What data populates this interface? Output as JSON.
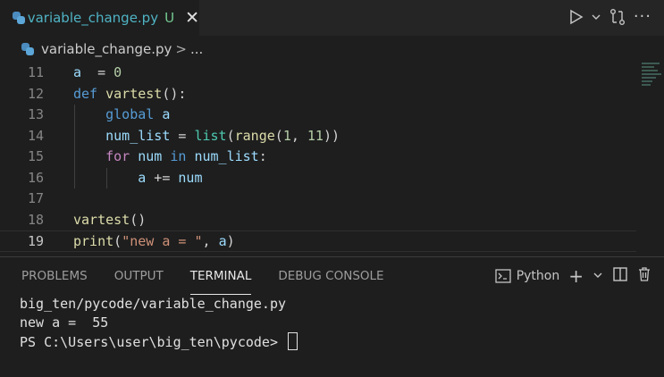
{
  "tab": {
    "filename": "variable_change.py",
    "status": "U"
  },
  "breadcrumb": {
    "file": "variable_change.py",
    "sep": ">",
    "more": "..."
  },
  "editor": {
    "lines": [
      {
        "num": "11",
        "tokens": [
          [
            "var",
            "a"
          ],
          [
            "",
            "  = "
          ],
          [
            "num",
            "0"
          ]
        ]
      },
      {
        "num": "12",
        "tokens": [
          [
            "kw",
            "def"
          ],
          [
            "",
            " "
          ],
          [
            "fn",
            "vartest"
          ],
          [
            "",
            "():"
          ]
        ]
      },
      {
        "num": "13",
        "tokens": [
          [
            "",
            "    "
          ],
          [
            "kw",
            "global"
          ],
          [
            "",
            " "
          ],
          [
            "var",
            "a"
          ]
        ]
      },
      {
        "num": "14",
        "tokens": [
          [
            "",
            "    "
          ],
          [
            "var",
            "num_list"
          ],
          [
            "",
            " = "
          ],
          [
            "bi",
            "list"
          ],
          [
            "",
            "("
          ],
          [
            "fn",
            "range"
          ],
          [
            "",
            "("
          ],
          [
            "num",
            "1"
          ],
          [
            "",
            ", "
          ],
          [
            "num",
            "11"
          ],
          [
            "",
            "))"
          ]
        ]
      },
      {
        "num": "15",
        "tokens": [
          [
            "",
            "    "
          ],
          [
            "kw2",
            "for"
          ],
          [
            "",
            " "
          ],
          [
            "var",
            "num"
          ],
          [
            "",
            " "
          ],
          [
            "kw",
            "in"
          ],
          [
            "",
            " "
          ],
          [
            "var",
            "num_list"
          ],
          [
            "",
            ":"
          ]
        ]
      },
      {
        "num": "16",
        "tokens": [
          [
            "",
            "        "
          ],
          [
            "var",
            "a"
          ],
          [
            "",
            " += "
          ],
          [
            "var",
            "num"
          ]
        ]
      },
      {
        "num": "17",
        "tokens": []
      },
      {
        "num": "18",
        "tokens": [
          [
            "fn",
            "vartest"
          ],
          [
            "",
            "()"
          ]
        ]
      },
      {
        "num": "19",
        "tokens": [
          [
            "fn",
            "print"
          ],
          [
            "",
            "("
          ],
          [
            "str",
            "\"new a = \""
          ],
          [
            "",
            ", "
          ],
          [
            "var",
            "a"
          ],
          [
            "",
            ")"
          ]
        ]
      }
    ]
  },
  "panel": {
    "tabs": [
      "PROBLEMS",
      "OUTPUT",
      "TERMINAL",
      "DEBUG CONSOLE"
    ],
    "active_tab": "TERMINAL",
    "terminal_name": "Python",
    "output_lines": [
      "big_ten/pycode/variable_change.py",
      "new a =  55",
      "PS C:\\Users\\user\\big_ten\\pycode> "
    ]
  }
}
